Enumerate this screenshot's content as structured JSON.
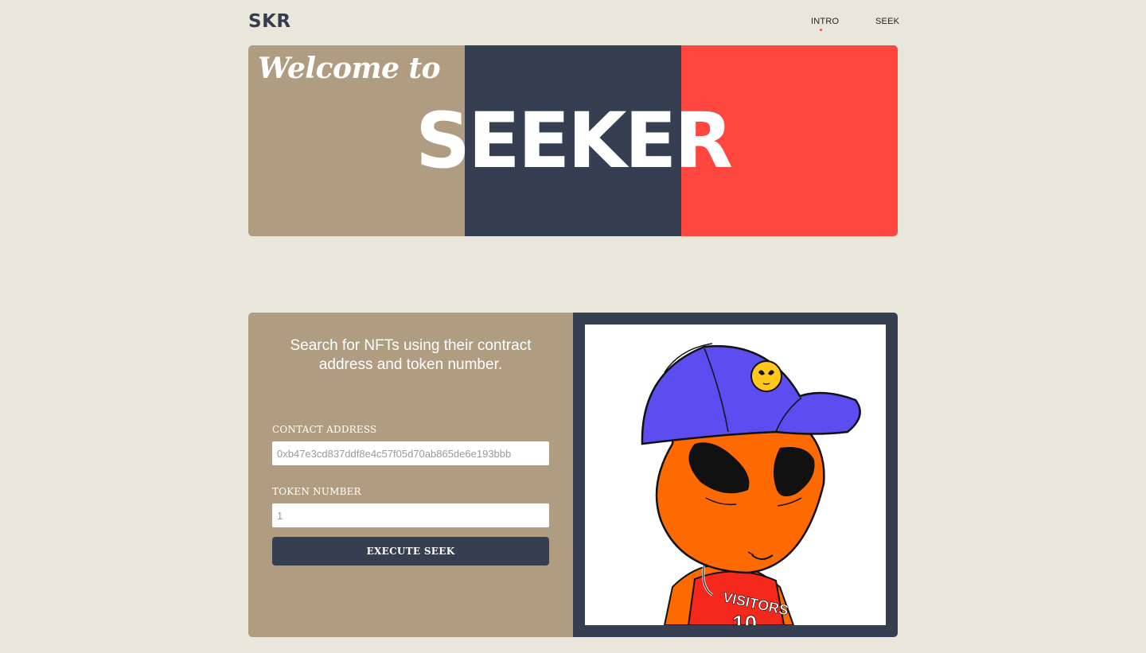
{
  "header": {
    "logo": "SKR",
    "nav": [
      {
        "label": "INTRO",
        "active": true
      },
      {
        "label": "SEEK",
        "active": false
      }
    ]
  },
  "hero": {
    "welcome": "Welcome to",
    "title": "SEEKER",
    "colors": [
      "#b09d81",
      "#363e52",
      "#ff473f"
    ]
  },
  "search": {
    "intro": "Search for NFTs using their contract address and token number.",
    "contract_label": "CONTACT ADDRESS",
    "contract_placeholder": "0xb47e3cd837ddf8e4c57f05d70ab865de6e193bbb",
    "token_label": "TOKEN NUMBER",
    "token_placeholder": "1",
    "execute_label": "EXECUTE SEEK"
  },
  "nft": {
    "jersey_text": "VISITORS",
    "jersey_number": "10"
  },
  "colors": {
    "background": "#e9e6db",
    "tan": "#b09d81",
    "navy": "#363e52",
    "red": "#ff473f"
  }
}
